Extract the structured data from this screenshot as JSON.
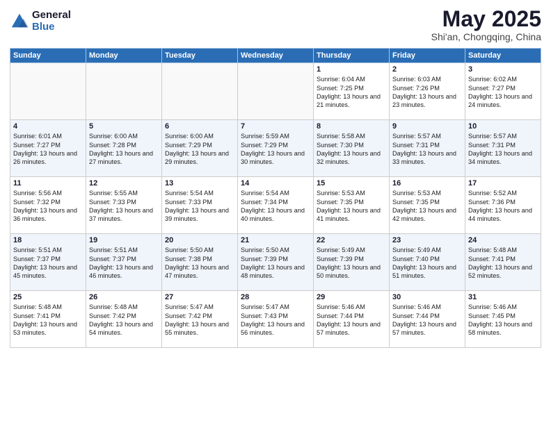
{
  "logo": {
    "general": "General",
    "blue": "Blue"
  },
  "title": {
    "month": "May 2025",
    "location": "Shi'an, Chongqing, China"
  },
  "weekdays": [
    "Sunday",
    "Monday",
    "Tuesday",
    "Wednesday",
    "Thursday",
    "Friday",
    "Saturday"
  ],
  "weeks": [
    [
      {
        "day": "",
        "info": ""
      },
      {
        "day": "",
        "info": ""
      },
      {
        "day": "",
        "info": ""
      },
      {
        "day": "",
        "info": ""
      },
      {
        "day": "1",
        "info": "Sunrise: 6:04 AM\nSunset: 7:25 PM\nDaylight: 13 hours and 21 minutes."
      },
      {
        "day": "2",
        "info": "Sunrise: 6:03 AM\nSunset: 7:26 PM\nDaylight: 13 hours and 23 minutes."
      },
      {
        "day": "3",
        "info": "Sunrise: 6:02 AM\nSunset: 7:27 PM\nDaylight: 13 hours and 24 minutes."
      }
    ],
    [
      {
        "day": "4",
        "info": "Sunrise: 6:01 AM\nSunset: 7:27 PM\nDaylight: 13 hours and 26 minutes."
      },
      {
        "day": "5",
        "info": "Sunrise: 6:00 AM\nSunset: 7:28 PM\nDaylight: 13 hours and 27 minutes."
      },
      {
        "day": "6",
        "info": "Sunrise: 6:00 AM\nSunset: 7:29 PM\nDaylight: 13 hours and 29 minutes."
      },
      {
        "day": "7",
        "info": "Sunrise: 5:59 AM\nSunset: 7:29 PM\nDaylight: 13 hours and 30 minutes."
      },
      {
        "day": "8",
        "info": "Sunrise: 5:58 AM\nSunset: 7:30 PM\nDaylight: 13 hours and 32 minutes."
      },
      {
        "day": "9",
        "info": "Sunrise: 5:57 AM\nSunset: 7:31 PM\nDaylight: 13 hours and 33 minutes."
      },
      {
        "day": "10",
        "info": "Sunrise: 5:57 AM\nSunset: 7:31 PM\nDaylight: 13 hours and 34 minutes."
      }
    ],
    [
      {
        "day": "11",
        "info": "Sunrise: 5:56 AM\nSunset: 7:32 PM\nDaylight: 13 hours and 36 minutes."
      },
      {
        "day": "12",
        "info": "Sunrise: 5:55 AM\nSunset: 7:33 PM\nDaylight: 13 hours and 37 minutes."
      },
      {
        "day": "13",
        "info": "Sunrise: 5:54 AM\nSunset: 7:33 PM\nDaylight: 13 hours and 39 minutes."
      },
      {
        "day": "14",
        "info": "Sunrise: 5:54 AM\nSunset: 7:34 PM\nDaylight: 13 hours and 40 minutes."
      },
      {
        "day": "15",
        "info": "Sunrise: 5:53 AM\nSunset: 7:35 PM\nDaylight: 13 hours and 41 minutes."
      },
      {
        "day": "16",
        "info": "Sunrise: 5:53 AM\nSunset: 7:35 PM\nDaylight: 13 hours and 42 minutes."
      },
      {
        "day": "17",
        "info": "Sunrise: 5:52 AM\nSunset: 7:36 PM\nDaylight: 13 hours and 44 minutes."
      }
    ],
    [
      {
        "day": "18",
        "info": "Sunrise: 5:51 AM\nSunset: 7:37 PM\nDaylight: 13 hours and 45 minutes."
      },
      {
        "day": "19",
        "info": "Sunrise: 5:51 AM\nSunset: 7:37 PM\nDaylight: 13 hours and 46 minutes."
      },
      {
        "day": "20",
        "info": "Sunrise: 5:50 AM\nSunset: 7:38 PM\nDaylight: 13 hours and 47 minutes."
      },
      {
        "day": "21",
        "info": "Sunrise: 5:50 AM\nSunset: 7:39 PM\nDaylight: 13 hours and 48 minutes."
      },
      {
        "day": "22",
        "info": "Sunrise: 5:49 AM\nSunset: 7:39 PM\nDaylight: 13 hours and 50 minutes."
      },
      {
        "day": "23",
        "info": "Sunrise: 5:49 AM\nSunset: 7:40 PM\nDaylight: 13 hours and 51 minutes."
      },
      {
        "day": "24",
        "info": "Sunrise: 5:48 AM\nSunset: 7:41 PM\nDaylight: 13 hours and 52 minutes."
      }
    ],
    [
      {
        "day": "25",
        "info": "Sunrise: 5:48 AM\nSunset: 7:41 PM\nDaylight: 13 hours and 53 minutes."
      },
      {
        "day": "26",
        "info": "Sunrise: 5:48 AM\nSunset: 7:42 PM\nDaylight: 13 hours and 54 minutes."
      },
      {
        "day": "27",
        "info": "Sunrise: 5:47 AM\nSunset: 7:42 PM\nDaylight: 13 hours and 55 minutes."
      },
      {
        "day": "28",
        "info": "Sunrise: 5:47 AM\nSunset: 7:43 PM\nDaylight: 13 hours and 56 minutes."
      },
      {
        "day": "29",
        "info": "Sunrise: 5:46 AM\nSunset: 7:44 PM\nDaylight: 13 hours and 57 minutes."
      },
      {
        "day": "30",
        "info": "Sunrise: 5:46 AM\nSunset: 7:44 PM\nDaylight: 13 hours and 57 minutes."
      },
      {
        "day": "31",
        "info": "Sunrise: 5:46 AM\nSunset: 7:45 PM\nDaylight: 13 hours and 58 minutes."
      }
    ]
  ]
}
